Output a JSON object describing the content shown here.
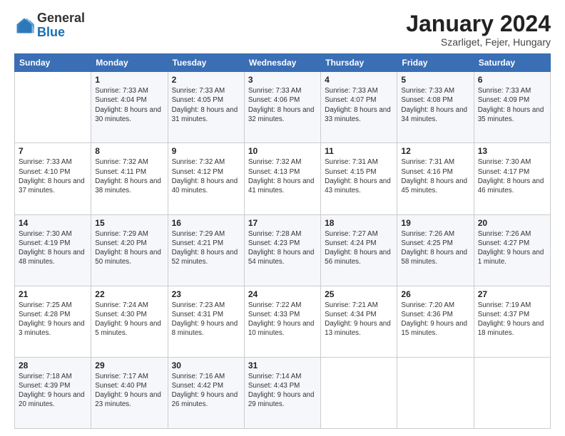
{
  "header": {
    "logo": {
      "general": "General",
      "blue": "Blue"
    },
    "title": "January 2024",
    "location": "Szarliget, Fejer, Hungary"
  },
  "weekdays": [
    "Sunday",
    "Monday",
    "Tuesday",
    "Wednesday",
    "Thursday",
    "Friday",
    "Saturday"
  ],
  "weeks": [
    [
      {
        "day": "",
        "sunrise": "",
        "sunset": "",
        "daylight": ""
      },
      {
        "day": "1",
        "sunrise": "Sunrise: 7:33 AM",
        "sunset": "Sunset: 4:04 PM",
        "daylight": "Daylight: 8 hours and 30 minutes."
      },
      {
        "day": "2",
        "sunrise": "Sunrise: 7:33 AM",
        "sunset": "Sunset: 4:05 PM",
        "daylight": "Daylight: 8 hours and 31 minutes."
      },
      {
        "day": "3",
        "sunrise": "Sunrise: 7:33 AM",
        "sunset": "Sunset: 4:06 PM",
        "daylight": "Daylight: 8 hours and 32 minutes."
      },
      {
        "day": "4",
        "sunrise": "Sunrise: 7:33 AM",
        "sunset": "Sunset: 4:07 PM",
        "daylight": "Daylight: 8 hours and 33 minutes."
      },
      {
        "day": "5",
        "sunrise": "Sunrise: 7:33 AM",
        "sunset": "Sunset: 4:08 PM",
        "daylight": "Daylight: 8 hours and 34 minutes."
      },
      {
        "day": "6",
        "sunrise": "Sunrise: 7:33 AM",
        "sunset": "Sunset: 4:09 PM",
        "daylight": "Daylight: 8 hours and 35 minutes."
      }
    ],
    [
      {
        "day": "7",
        "sunrise": "Sunrise: 7:33 AM",
        "sunset": "Sunset: 4:10 PM",
        "daylight": "Daylight: 8 hours and 37 minutes."
      },
      {
        "day": "8",
        "sunrise": "Sunrise: 7:32 AM",
        "sunset": "Sunset: 4:11 PM",
        "daylight": "Daylight: 8 hours and 38 minutes."
      },
      {
        "day": "9",
        "sunrise": "Sunrise: 7:32 AM",
        "sunset": "Sunset: 4:12 PM",
        "daylight": "Daylight: 8 hours and 40 minutes."
      },
      {
        "day": "10",
        "sunrise": "Sunrise: 7:32 AM",
        "sunset": "Sunset: 4:13 PM",
        "daylight": "Daylight: 8 hours and 41 minutes."
      },
      {
        "day": "11",
        "sunrise": "Sunrise: 7:31 AM",
        "sunset": "Sunset: 4:15 PM",
        "daylight": "Daylight: 8 hours and 43 minutes."
      },
      {
        "day": "12",
        "sunrise": "Sunrise: 7:31 AM",
        "sunset": "Sunset: 4:16 PM",
        "daylight": "Daylight: 8 hours and 45 minutes."
      },
      {
        "day": "13",
        "sunrise": "Sunrise: 7:30 AM",
        "sunset": "Sunset: 4:17 PM",
        "daylight": "Daylight: 8 hours and 46 minutes."
      }
    ],
    [
      {
        "day": "14",
        "sunrise": "Sunrise: 7:30 AM",
        "sunset": "Sunset: 4:19 PM",
        "daylight": "Daylight: 8 hours and 48 minutes."
      },
      {
        "day": "15",
        "sunrise": "Sunrise: 7:29 AM",
        "sunset": "Sunset: 4:20 PM",
        "daylight": "Daylight: 8 hours and 50 minutes."
      },
      {
        "day": "16",
        "sunrise": "Sunrise: 7:29 AM",
        "sunset": "Sunset: 4:21 PM",
        "daylight": "Daylight: 8 hours and 52 minutes."
      },
      {
        "day": "17",
        "sunrise": "Sunrise: 7:28 AM",
        "sunset": "Sunset: 4:23 PM",
        "daylight": "Daylight: 8 hours and 54 minutes."
      },
      {
        "day": "18",
        "sunrise": "Sunrise: 7:27 AM",
        "sunset": "Sunset: 4:24 PM",
        "daylight": "Daylight: 8 hours and 56 minutes."
      },
      {
        "day": "19",
        "sunrise": "Sunrise: 7:26 AM",
        "sunset": "Sunset: 4:25 PM",
        "daylight": "Daylight: 8 hours and 58 minutes."
      },
      {
        "day": "20",
        "sunrise": "Sunrise: 7:26 AM",
        "sunset": "Sunset: 4:27 PM",
        "daylight": "Daylight: 9 hours and 1 minute."
      }
    ],
    [
      {
        "day": "21",
        "sunrise": "Sunrise: 7:25 AM",
        "sunset": "Sunset: 4:28 PM",
        "daylight": "Daylight: 9 hours and 3 minutes."
      },
      {
        "day": "22",
        "sunrise": "Sunrise: 7:24 AM",
        "sunset": "Sunset: 4:30 PM",
        "daylight": "Daylight: 9 hours and 5 minutes."
      },
      {
        "day": "23",
        "sunrise": "Sunrise: 7:23 AM",
        "sunset": "Sunset: 4:31 PM",
        "daylight": "Daylight: 9 hours and 8 minutes."
      },
      {
        "day": "24",
        "sunrise": "Sunrise: 7:22 AM",
        "sunset": "Sunset: 4:33 PM",
        "daylight": "Daylight: 9 hours and 10 minutes."
      },
      {
        "day": "25",
        "sunrise": "Sunrise: 7:21 AM",
        "sunset": "Sunset: 4:34 PM",
        "daylight": "Daylight: 9 hours and 13 minutes."
      },
      {
        "day": "26",
        "sunrise": "Sunrise: 7:20 AM",
        "sunset": "Sunset: 4:36 PM",
        "daylight": "Daylight: 9 hours and 15 minutes."
      },
      {
        "day": "27",
        "sunrise": "Sunrise: 7:19 AM",
        "sunset": "Sunset: 4:37 PM",
        "daylight": "Daylight: 9 hours and 18 minutes."
      }
    ],
    [
      {
        "day": "28",
        "sunrise": "Sunrise: 7:18 AM",
        "sunset": "Sunset: 4:39 PM",
        "daylight": "Daylight: 9 hours and 20 minutes."
      },
      {
        "day": "29",
        "sunrise": "Sunrise: 7:17 AM",
        "sunset": "Sunset: 4:40 PM",
        "daylight": "Daylight: 9 hours and 23 minutes."
      },
      {
        "day": "30",
        "sunrise": "Sunrise: 7:16 AM",
        "sunset": "Sunset: 4:42 PM",
        "daylight": "Daylight: 9 hours and 26 minutes."
      },
      {
        "day": "31",
        "sunrise": "Sunrise: 7:14 AM",
        "sunset": "Sunset: 4:43 PM",
        "daylight": "Daylight: 9 hours and 29 minutes."
      },
      {
        "day": "",
        "sunrise": "",
        "sunset": "",
        "daylight": ""
      },
      {
        "day": "",
        "sunrise": "",
        "sunset": "",
        "daylight": ""
      },
      {
        "day": "",
        "sunrise": "",
        "sunset": "",
        "daylight": ""
      }
    ]
  ]
}
